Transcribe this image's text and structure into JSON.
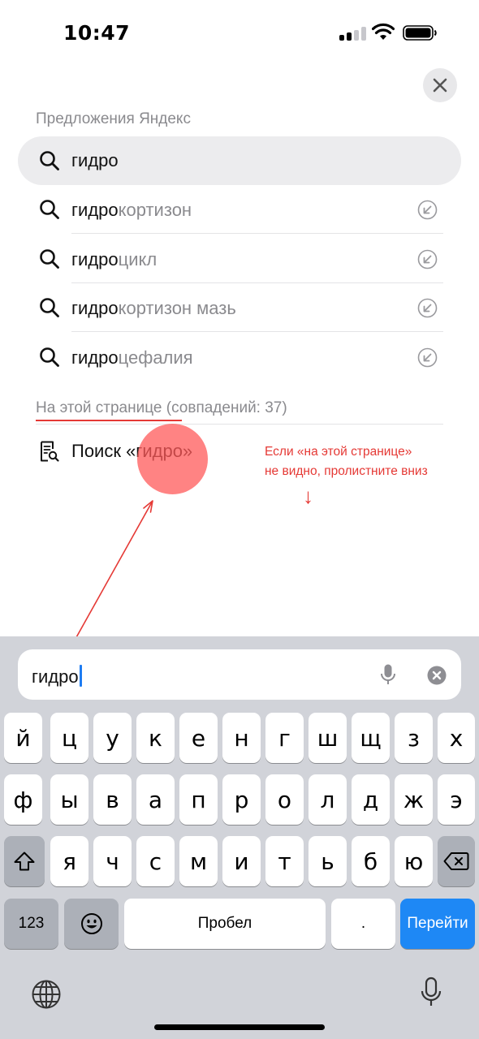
{
  "status_bar": {
    "time": "10:47"
  },
  "sections": {
    "suggestions_title": "Предложения Яндекс",
    "on_page_title": "На этой странице (совпадений: 37)"
  },
  "query": "гидро",
  "suggestions": [
    {
      "bold": "гидро",
      "rest": "кортизон"
    },
    {
      "bold": "гидро",
      "rest": "цикл"
    },
    {
      "bold": "гидро",
      "rest": "кортизон мазь"
    },
    {
      "bold": "гидро",
      "rest": "цефалия"
    }
  ],
  "page_search": {
    "label": "Поиск «гидро»"
  },
  "annotation": {
    "line1": "Если «на этой странице»",
    "line2": "не видно, пролистните вниз",
    "down_arrow": "↓"
  },
  "input": {
    "value": "гидро"
  },
  "keyboard": {
    "row1": [
      "й",
      "ц",
      "у",
      "к",
      "е",
      "н",
      "г",
      "ш",
      "щ",
      "з",
      "х"
    ],
    "row2": [
      "ф",
      "ы",
      "в",
      "а",
      "п",
      "р",
      "о",
      "л",
      "д",
      "ж",
      "э"
    ],
    "row3": [
      "я",
      "ч",
      "с",
      "м",
      "и",
      "т",
      "ь",
      "б",
      "ю"
    ],
    "numbers_key": "123",
    "space_key": "Пробел",
    "period_key": ".",
    "go_key": "Перейти"
  },
  "colors": {
    "accent": "#1e88f5",
    "annotation": "#e53935",
    "tap_marker": "#ff5a5a"
  }
}
